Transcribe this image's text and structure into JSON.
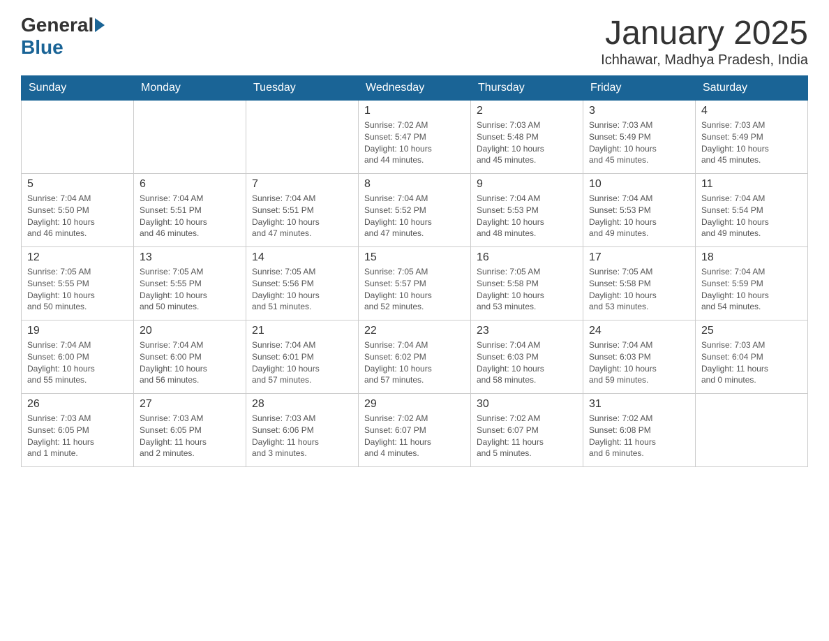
{
  "header": {
    "logo_general": "General",
    "logo_blue": "Blue",
    "month_title": "January 2025",
    "location": "Ichhawar, Madhya Pradesh, India"
  },
  "weekdays": [
    "Sunday",
    "Monday",
    "Tuesday",
    "Wednesday",
    "Thursday",
    "Friday",
    "Saturday"
  ],
  "weeks": [
    [
      {
        "day": "",
        "info": ""
      },
      {
        "day": "",
        "info": ""
      },
      {
        "day": "",
        "info": ""
      },
      {
        "day": "1",
        "info": "Sunrise: 7:02 AM\nSunset: 5:47 PM\nDaylight: 10 hours\nand 44 minutes."
      },
      {
        "day": "2",
        "info": "Sunrise: 7:03 AM\nSunset: 5:48 PM\nDaylight: 10 hours\nand 45 minutes."
      },
      {
        "day": "3",
        "info": "Sunrise: 7:03 AM\nSunset: 5:49 PM\nDaylight: 10 hours\nand 45 minutes."
      },
      {
        "day": "4",
        "info": "Sunrise: 7:03 AM\nSunset: 5:49 PM\nDaylight: 10 hours\nand 45 minutes."
      }
    ],
    [
      {
        "day": "5",
        "info": "Sunrise: 7:04 AM\nSunset: 5:50 PM\nDaylight: 10 hours\nand 46 minutes."
      },
      {
        "day": "6",
        "info": "Sunrise: 7:04 AM\nSunset: 5:51 PM\nDaylight: 10 hours\nand 46 minutes."
      },
      {
        "day": "7",
        "info": "Sunrise: 7:04 AM\nSunset: 5:51 PM\nDaylight: 10 hours\nand 47 minutes."
      },
      {
        "day": "8",
        "info": "Sunrise: 7:04 AM\nSunset: 5:52 PM\nDaylight: 10 hours\nand 47 minutes."
      },
      {
        "day": "9",
        "info": "Sunrise: 7:04 AM\nSunset: 5:53 PM\nDaylight: 10 hours\nand 48 minutes."
      },
      {
        "day": "10",
        "info": "Sunrise: 7:04 AM\nSunset: 5:53 PM\nDaylight: 10 hours\nand 49 minutes."
      },
      {
        "day": "11",
        "info": "Sunrise: 7:04 AM\nSunset: 5:54 PM\nDaylight: 10 hours\nand 49 minutes."
      }
    ],
    [
      {
        "day": "12",
        "info": "Sunrise: 7:05 AM\nSunset: 5:55 PM\nDaylight: 10 hours\nand 50 minutes."
      },
      {
        "day": "13",
        "info": "Sunrise: 7:05 AM\nSunset: 5:55 PM\nDaylight: 10 hours\nand 50 minutes."
      },
      {
        "day": "14",
        "info": "Sunrise: 7:05 AM\nSunset: 5:56 PM\nDaylight: 10 hours\nand 51 minutes."
      },
      {
        "day": "15",
        "info": "Sunrise: 7:05 AM\nSunset: 5:57 PM\nDaylight: 10 hours\nand 52 minutes."
      },
      {
        "day": "16",
        "info": "Sunrise: 7:05 AM\nSunset: 5:58 PM\nDaylight: 10 hours\nand 53 minutes."
      },
      {
        "day": "17",
        "info": "Sunrise: 7:05 AM\nSunset: 5:58 PM\nDaylight: 10 hours\nand 53 minutes."
      },
      {
        "day": "18",
        "info": "Sunrise: 7:04 AM\nSunset: 5:59 PM\nDaylight: 10 hours\nand 54 minutes."
      }
    ],
    [
      {
        "day": "19",
        "info": "Sunrise: 7:04 AM\nSunset: 6:00 PM\nDaylight: 10 hours\nand 55 minutes."
      },
      {
        "day": "20",
        "info": "Sunrise: 7:04 AM\nSunset: 6:00 PM\nDaylight: 10 hours\nand 56 minutes."
      },
      {
        "day": "21",
        "info": "Sunrise: 7:04 AM\nSunset: 6:01 PM\nDaylight: 10 hours\nand 57 minutes."
      },
      {
        "day": "22",
        "info": "Sunrise: 7:04 AM\nSunset: 6:02 PM\nDaylight: 10 hours\nand 57 minutes."
      },
      {
        "day": "23",
        "info": "Sunrise: 7:04 AM\nSunset: 6:03 PM\nDaylight: 10 hours\nand 58 minutes."
      },
      {
        "day": "24",
        "info": "Sunrise: 7:04 AM\nSunset: 6:03 PM\nDaylight: 10 hours\nand 59 minutes."
      },
      {
        "day": "25",
        "info": "Sunrise: 7:03 AM\nSunset: 6:04 PM\nDaylight: 11 hours\nand 0 minutes."
      }
    ],
    [
      {
        "day": "26",
        "info": "Sunrise: 7:03 AM\nSunset: 6:05 PM\nDaylight: 11 hours\nand 1 minute."
      },
      {
        "day": "27",
        "info": "Sunrise: 7:03 AM\nSunset: 6:05 PM\nDaylight: 11 hours\nand 2 minutes."
      },
      {
        "day": "28",
        "info": "Sunrise: 7:03 AM\nSunset: 6:06 PM\nDaylight: 11 hours\nand 3 minutes."
      },
      {
        "day": "29",
        "info": "Sunrise: 7:02 AM\nSunset: 6:07 PM\nDaylight: 11 hours\nand 4 minutes."
      },
      {
        "day": "30",
        "info": "Sunrise: 7:02 AM\nSunset: 6:07 PM\nDaylight: 11 hours\nand 5 minutes."
      },
      {
        "day": "31",
        "info": "Sunrise: 7:02 AM\nSunset: 6:08 PM\nDaylight: 11 hours\nand 6 minutes."
      },
      {
        "day": "",
        "info": ""
      }
    ]
  ]
}
